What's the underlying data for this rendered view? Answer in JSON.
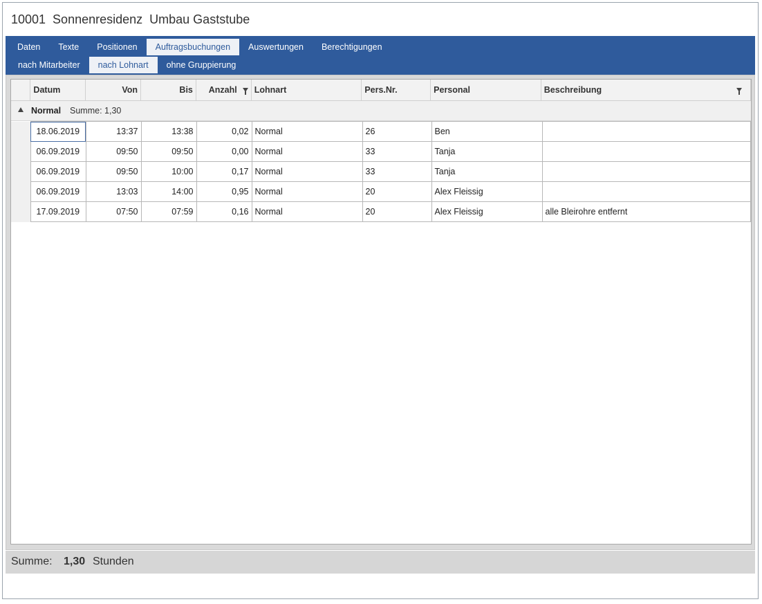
{
  "window": {
    "title": "10001  Sonnenresidenz  Umbau Gaststube"
  },
  "tabs": {
    "main": [
      "Daten",
      "Texte",
      "Positionen",
      "Auftragsbuchungen",
      "Auswertungen",
      "Berechtigungen"
    ],
    "main_active": "Auftragsbuchungen",
    "sub": [
      "nach Mitarbeiter",
      "nach Lohnart",
      "ohne Gruppierung"
    ],
    "sub_active": "nach Lohnart"
  },
  "grid": {
    "columns": [
      "Datum",
      "Von",
      "Bis",
      "Anzahl",
      "Lohnart",
      "Pers.Nr.",
      "Personal",
      "Beschreibung"
    ],
    "filter_icon": "filter-icon",
    "group": {
      "label": "Normal",
      "sum_label": "Summe:",
      "sum_value": "1,30",
      "toggle_icon": "triangle-up-icon"
    },
    "rows": [
      [
        "18.06.2019",
        "13:37",
        "13:38",
        "0,02",
        "Normal",
        "26",
        "Ben",
        ""
      ],
      [
        "06.09.2019",
        "09:50",
        "09:50",
        "0,00",
        "Normal",
        "33",
        "Tanja",
        ""
      ],
      [
        "06.09.2019",
        "09:50",
        "10:00",
        "0,17",
        "Normal",
        "33",
        "Tanja",
        ""
      ],
      [
        "06.09.2019",
        "13:03",
        "14:00",
        "0,95",
        "Normal",
        "20",
        "Alex Fleissig",
        ""
      ],
      [
        "17.09.2019",
        "07:50",
        "07:59",
        "0,16",
        "Normal",
        "20",
        "Alex Fleissig",
        "alle Bleirohre entfernt"
      ]
    ]
  },
  "footer": {
    "label": "Summe:",
    "value": "1,30",
    "unit": "Stunden"
  },
  "colors": {
    "tab_bar": "#2f5b9c",
    "active_tab_bg": "#eef1f6",
    "footer_bg": "#d6d6d6"
  }
}
